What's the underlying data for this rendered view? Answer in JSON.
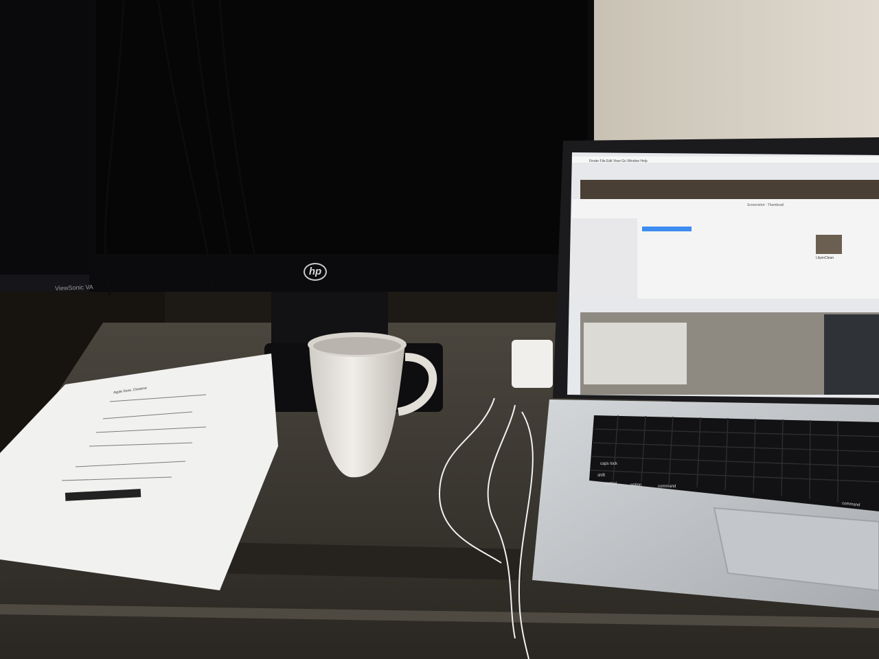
{
  "scene": {
    "monitor": {
      "brand": "hp"
    },
    "side_monitor": {
      "brand_text": "ViewSonic VA"
    },
    "receipt": {
      "vendor": "Apple Store, Chestnut"
    },
    "laptop": {
      "menu_bar": "Finder   File   Edit   View   Go   Window   Help",
      "finder_title": "Screenshot - Thumbnail",
      "file_name": "LilyenClean",
      "keyboard": {
        "caps_lock": "caps lock",
        "shift": "shift",
        "control": "control",
        "option": "option",
        "command_left": "command",
        "command_right": "command"
      }
    }
  },
  "colors": {
    "wall": "#d6cfc2",
    "desk_glass": "#3c3830",
    "monitor_bezel": "#0b0b0d",
    "laptop_silver": "#b9bcc0",
    "mug": "#e6e3de",
    "paper": "#f2f2f0"
  }
}
